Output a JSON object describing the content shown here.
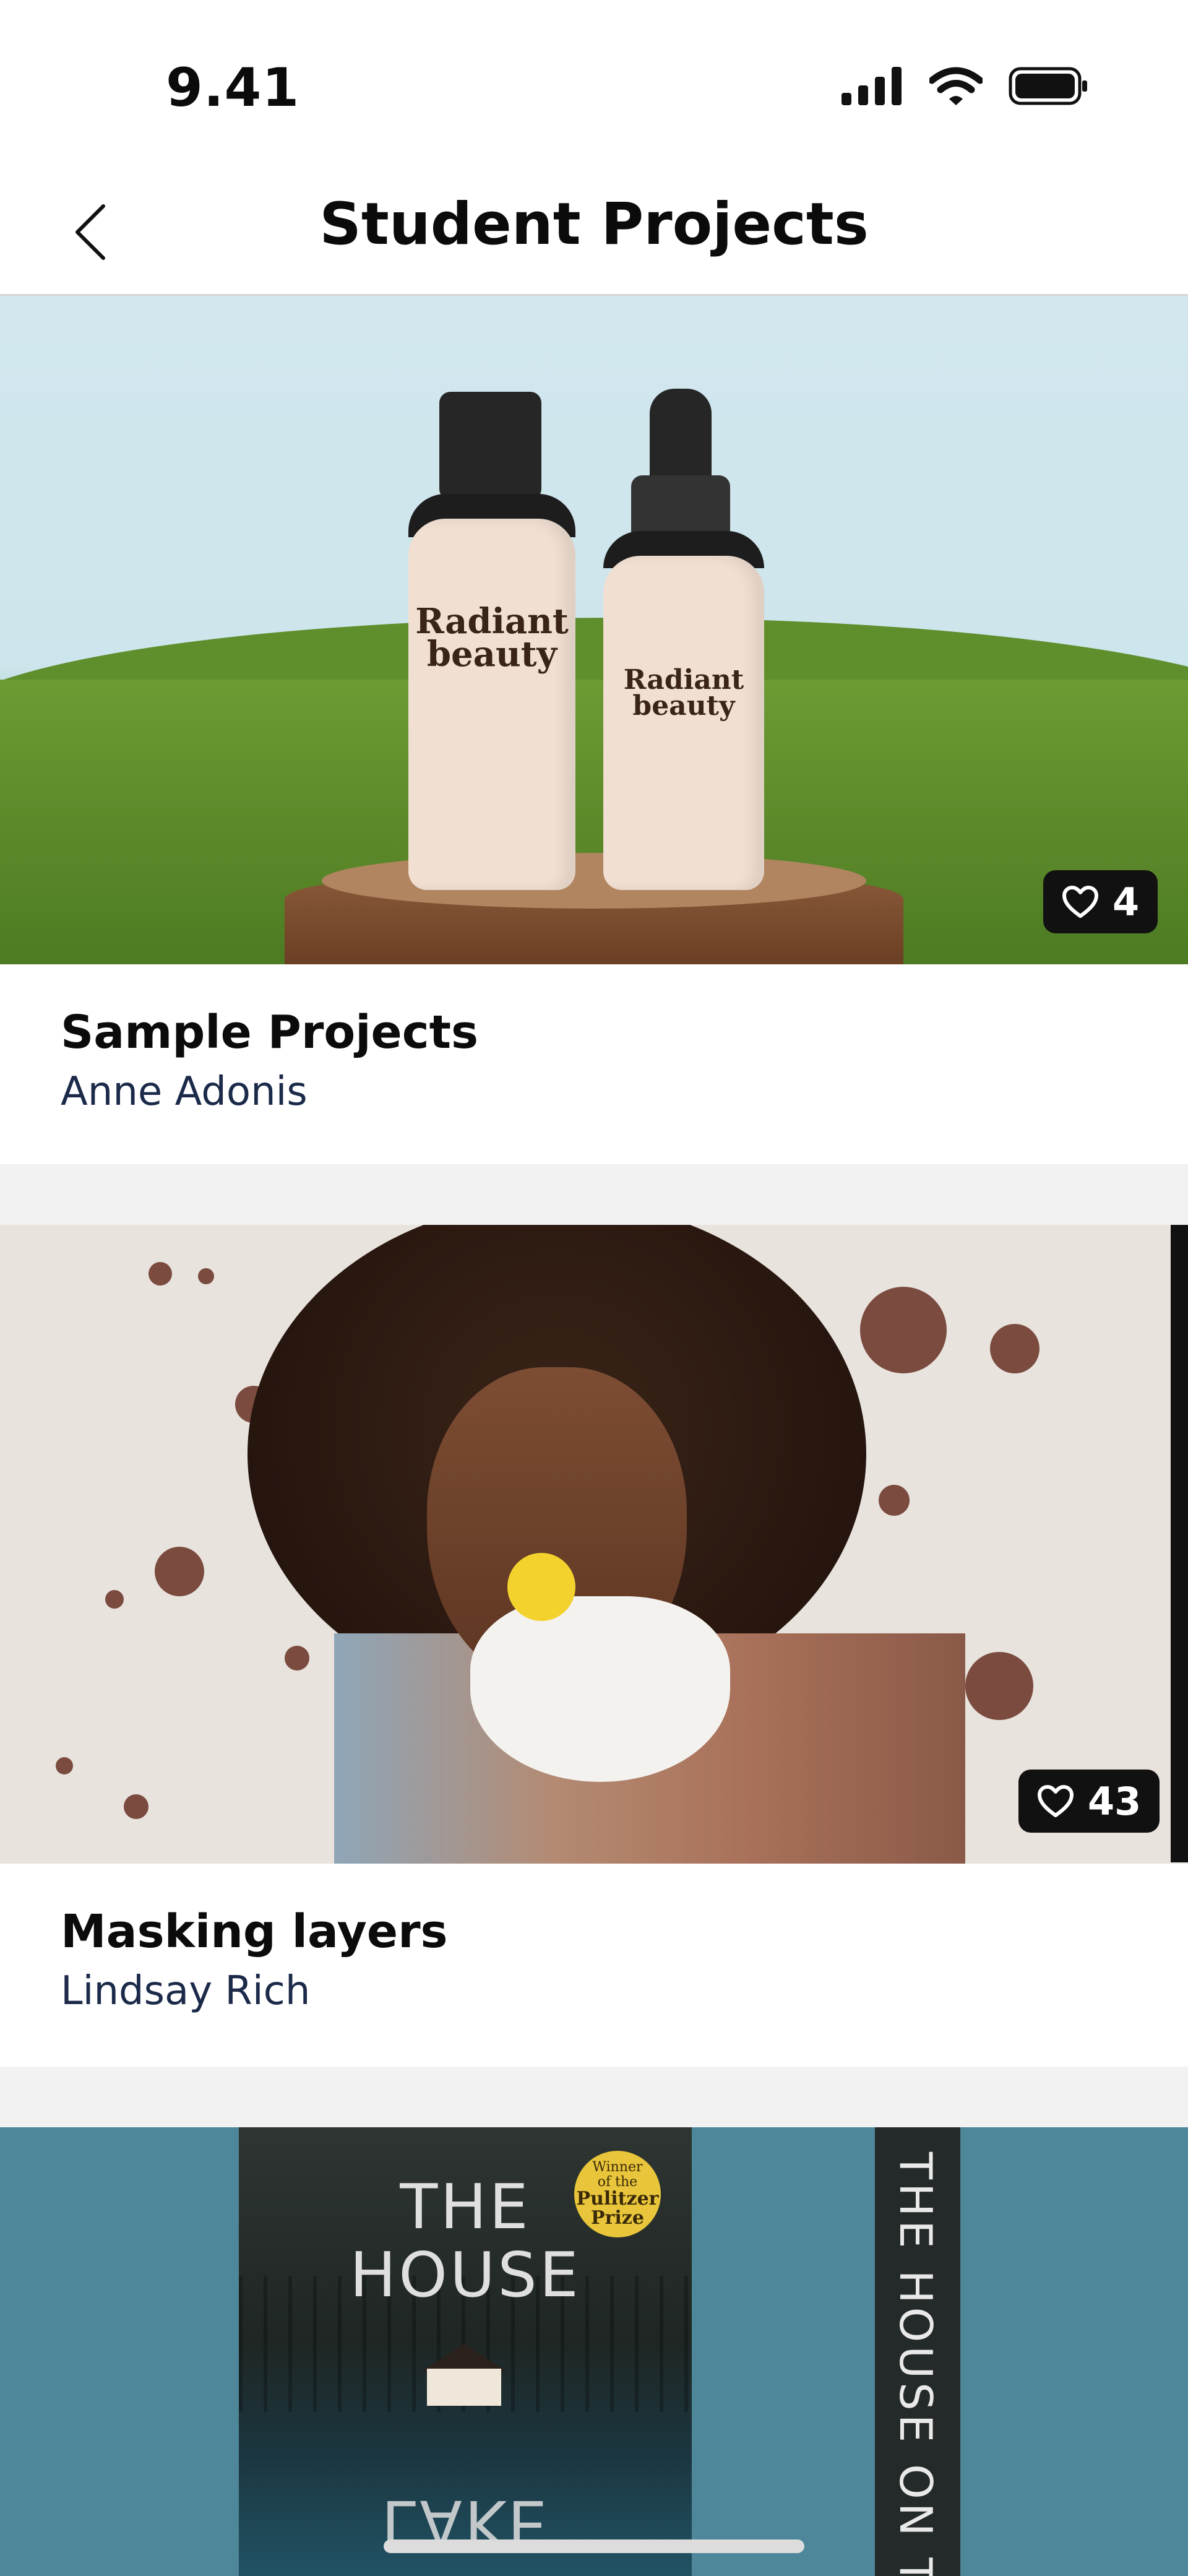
{
  "status_bar": {
    "time": "9.41"
  },
  "header": {
    "title": "Student Projects"
  },
  "projects": [
    {
      "title": "Sample Projects",
      "author": "Anne Adonis",
      "likes": "4",
      "image": {
        "brand_line1": "Radiant",
        "brand_line2": "beauty"
      }
    },
    {
      "title": "Masking layers",
      "author": "Lindsay Rich",
      "likes": "43"
    },
    {
      "image": {
        "title_line1": "THE",
        "title_line2": "HOUSE",
        "title_mirror": "LAKE",
        "prize_line1": "Winner",
        "prize_line2": "of the",
        "prize_line3": "Pulitzer",
        "prize_line4": "Prize",
        "spine": "THE HOUSE ON TH"
      }
    }
  ],
  "colors": {
    "accent": "#111111",
    "band": "#f2f2f2",
    "author": "#1c2a4a"
  }
}
